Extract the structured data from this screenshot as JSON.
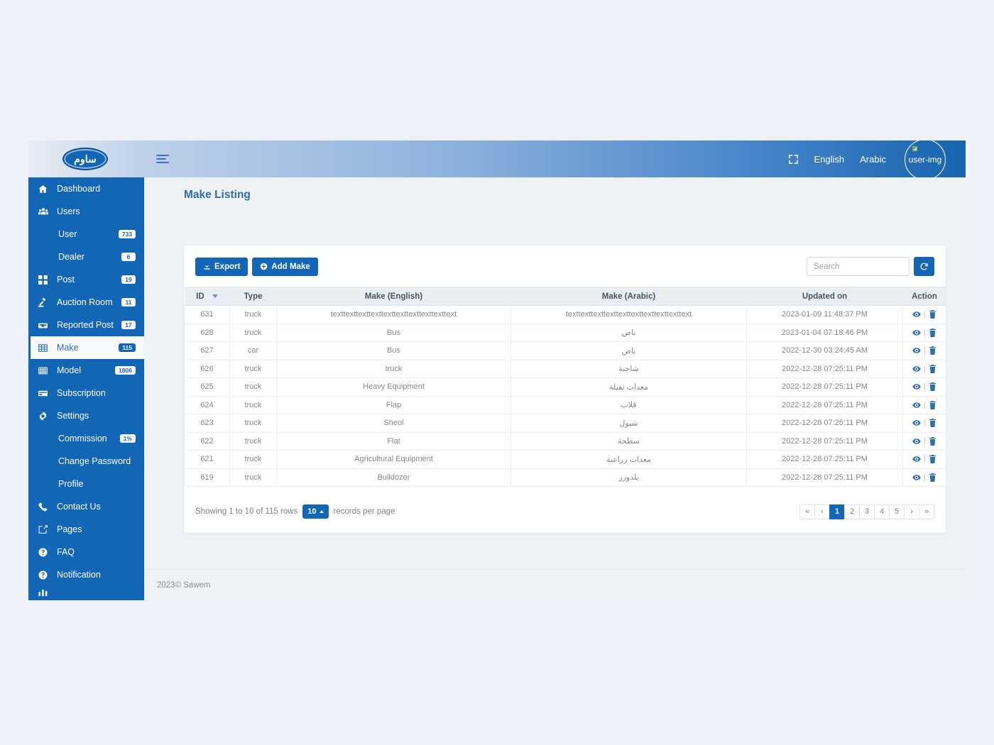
{
  "brand": {
    "logo_text": "ساوم",
    "accent": "#1266b5"
  },
  "topbar": {
    "fullscreen_icon": "expand-icon",
    "menu_icon": "hamburger-icon",
    "links": [
      {
        "label": "English",
        "name": "lang-english"
      },
      {
        "label": "Arabic",
        "name": "lang-arabic"
      }
    ],
    "avatar_alt": "user-img"
  },
  "sidebar": {
    "items": [
      {
        "label": "Dashboard",
        "icon": "home-icon",
        "badge": null,
        "sub": false,
        "active": false
      },
      {
        "label": "Users",
        "icon": "users-icon",
        "badge": null,
        "sub": false,
        "active": false
      },
      {
        "label": "User",
        "icon": null,
        "badge": "733",
        "sub": true,
        "active": false
      },
      {
        "label": "Dealer",
        "icon": null,
        "badge": "6",
        "sub": true,
        "active": false
      },
      {
        "label": "Post",
        "icon": "grid-icon",
        "badge": "19",
        "sub": false,
        "active": false
      },
      {
        "label": "Auction Room",
        "icon": "gavel-icon",
        "badge": "11",
        "sub": false,
        "active": false
      },
      {
        "label": "Reported Post",
        "icon": "inbox-icon",
        "badge": "17",
        "sub": false,
        "active": false
      },
      {
        "label": "Make",
        "icon": "table-icon",
        "badge": "115",
        "sub": false,
        "active": true
      },
      {
        "label": "Model",
        "icon": "grid-table-icon",
        "badge": "1806",
        "sub": false,
        "active": false
      },
      {
        "label": "Subscription",
        "icon": "card-icon",
        "badge": null,
        "sub": false,
        "active": false
      },
      {
        "label": "Settings",
        "icon": "gear-icon",
        "badge": null,
        "sub": false,
        "active": false
      },
      {
        "label": "Commission",
        "icon": null,
        "badge": "1%",
        "sub": true,
        "active": false
      },
      {
        "label": "Change Password",
        "icon": null,
        "badge": null,
        "sub": true,
        "active": false
      },
      {
        "label": "Profile",
        "icon": null,
        "badge": null,
        "sub": true,
        "active": false
      },
      {
        "label": "Contact Us",
        "icon": "phone-icon",
        "badge": null,
        "sub": false,
        "active": false
      },
      {
        "label": "Pages",
        "icon": "edit-square-icon",
        "badge": null,
        "sub": false,
        "active": false
      },
      {
        "label": "FAQ",
        "icon": "question-circle-icon",
        "badge": null,
        "sub": false,
        "active": false
      },
      {
        "label": "Notification",
        "icon": "question-circle-icon",
        "badge": null,
        "sub": false,
        "active": false
      }
    ]
  },
  "page": {
    "title": "Make Listing"
  },
  "toolbar": {
    "export_label": "Export",
    "add_label": "Add Make",
    "search_placeholder": "Search",
    "search_value": "",
    "refresh_icon": "refresh-icon"
  },
  "table": {
    "columns": [
      "ID",
      "Type",
      "Make (English)",
      "Make (Arabic)",
      "Updated on",
      "Action"
    ],
    "sorted_column": "ID",
    "sort_direction": "desc",
    "rows": [
      {
        "id": "631",
        "type": "truck",
        "make_en": "texttexttexttexttexttexttexttexttexttext",
        "make_ar": "texttexttexttexttexttexttexttexttexttext",
        "updated": "2023-01-09 11:48:37 PM"
      },
      {
        "id": "628",
        "type": "truck",
        "make_en": "Bus",
        "make_ar": "باص",
        "updated": "2023-01-04 07:18:46 PM"
      },
      {
        "id": "627",
        "type": "car",
        "make_en": "Bus",
        "make_ar": "باص",
        "updated": "2022-12-30 03:24:45 AM"
      },
      {
        "id": "626",
        "type": "truck",
        "make_en": "truck",
        "make_ar": "شاحنة",
        "updated": "2022-12-28 07:25:11 PM"
      },
      {
        "id": "625",
        "type": "truck",
        "make_en": "Heavy Equipment",
        "make_ar": "معدات ثقيلة",
        "updated": "2022-12-28 07:25:11 PM"
      },
      {
        "id": "624",
        "type": "truck",
        "make_en": "Flap",
        "make_ar": "قلاب",
        "updated": "2022-12-28 07:25:11 PM"
      },
      {
        "id": "623",
        "type": "truck",
        "make_en": "Sheol",
        "make_ar": "شيول",
        "updated": "2022-12-28 07:25:11 PM"
      },
      {
        "id": "622",
        "type": "truck",
        "make_en": "Flat",
        "make_ar": "سطحة",
        "updated": "2022-12-28 07:25:11 PM"
      },
      {
        "id": "621",
        "type": "truck",
        "make_en": "Agricultural Equipment",
        "make_ar": "معدات زراعية",
        "updated": "2022-12-28 07:25:11 PM"
      },
      {
        "id": "619",
        "type": "truck",
        "make_en": "Bulldozer",
        "make_ar": "بلدوزر",
        "updated": "2022-12-28 07:25:11 PM"
      }
    ],
    "row_actions": {
      "view_icon": "eye-icon",
      "delete_icon": "trash-icon",
      "separator": "|"
    }
  },
  "footer_bar": {
    "showing_text": "Showing 1 to 10 of 115 rows",
    "per_page_value": "10",
    "per_page_suffix": "records per page",
    "pagination": [
      {
        "label": "«",
        "name": "page-first",
        "active": false
      },
      {
        "label": "‹",
        "name": "page-prev",
        "active": false
      },
      {
        "label": "1",
        "name": "page-1",
        "active": true
      },
      {
        "label": "2",
        "name": "page-2",
        "active": false
      },
      {
        "label": "3",
        "name": "page-3",
        "active": false
      },
      {
        "label": "4",
        "name": "page-4",
        "active": false
      },
      {
        "label": "5",
        "name": "page-5",
        "active": false
      },
      {
        "label": "›",
        "name": "page-next",
        "active": false
      },
      {
        "label": "»",
        "name": "page-last",
        "active": false
      }
    ]
  },
  "page_footer": {
    "copyright": "2023© Sawem"
  }
}
